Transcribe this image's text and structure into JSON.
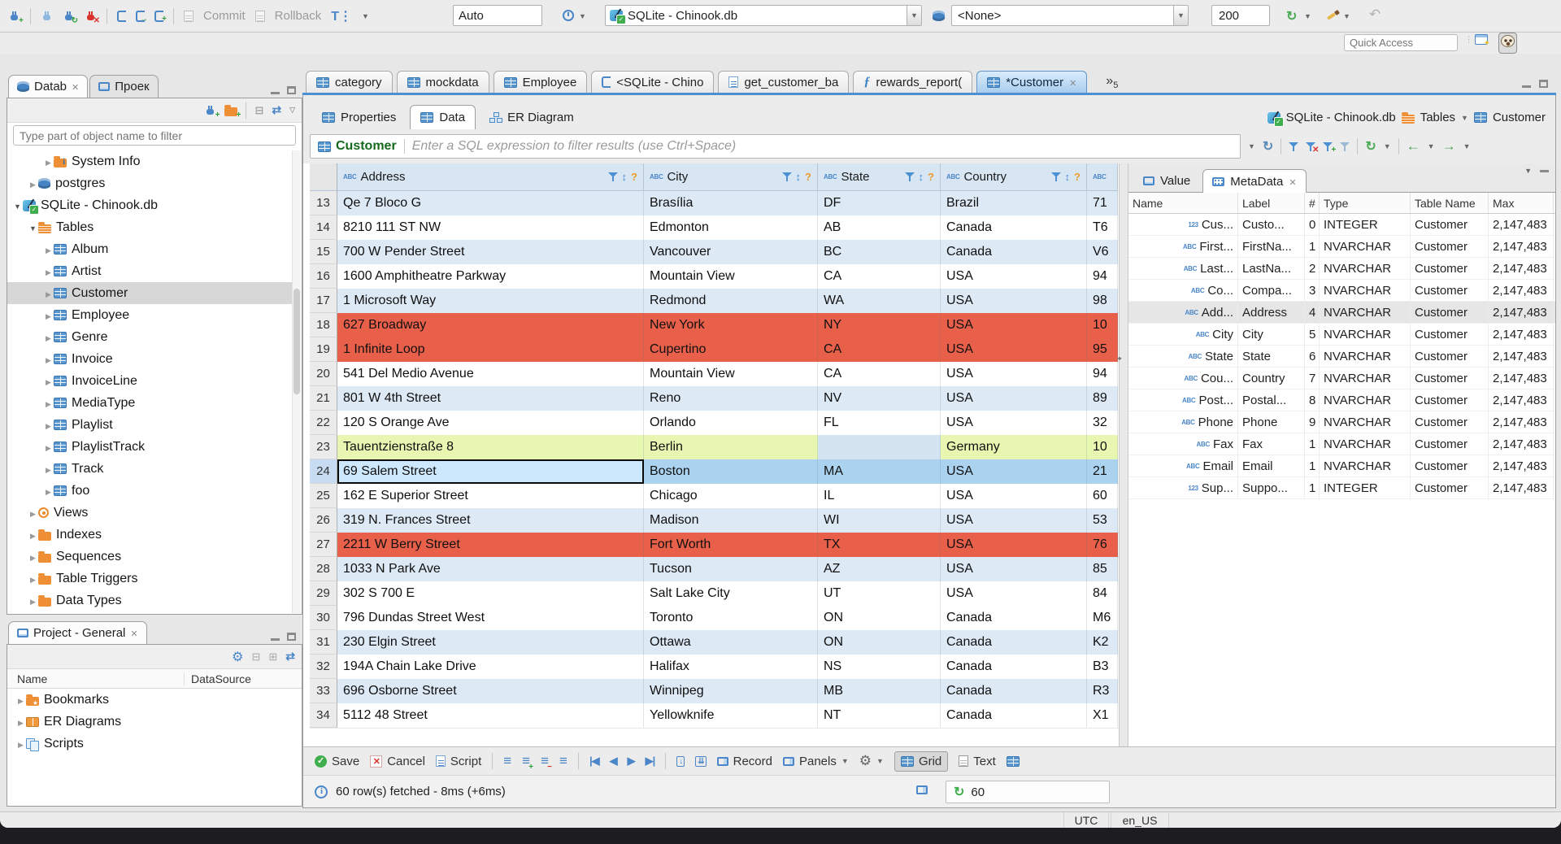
{
  "main_toolbar": {
    "commit_label": "Commit",
    "rollback_label": "Rollback",
    "auto_value": "Auto",
    "connection_value": "SQLite - Chinook.db",
    "schema_value": "<None>",
    "fetch_size_value": "200",
    "quick_access_placeholder": "Quick Access"
  },
  "editor_tabs": {
    "tabs": [
      {
        "label": "category",
        "icon": "table"
      },
      {
        "label": "mockdata",
        "icon": "table"
      },
      {
        "label": "Employee",
        "icon": "table"
      },
      {
        "label": "<SQLite - Chino",
        "icon": "sql"
      },
      {
        "label": "get_customer_ba",
        "icon": "script"
      },
      {
        "label": "rewards_report(",
        "icon": "func"
      },
      {
        "label": "*Customer",
        "icon": "table",
        "active": true,
        "close": true
      }
    ],
    "overflow_chevron": "»",
    "overflow_count": "5"
  },
  "subtabs": {
    "properties": "Properties",
    "data": "Data",
    "er_diagram": "ER Diagram"
  },
  "breadcrumb": {
    "db": "SQLite - Chinook.db",
    "tables": "Tables",
    "table": "Customer"
  },
  "filter_bar": {
    "table_label": "Customer",
    "placeholder": "Enter a SQL expression to filter results (use Ctrl+Space)"
  },
  "navigator": {
    "tab_database": "Datab",
    "tab_projects": "Проек",
    "filter_placeholder": "Type part of object name to filter",
    "tree": [
      {
        "label": "System Info",
        "icon": "folder-info",
        "depth": 3,
        "expander": "collapsed"
      },
      {
        "label": "postgres",
        "icon": "db",
        "depth": 2,
        "expander": "collapsed"
      },
      {
        "label": "SQLite - Chinook.db",
        "icon": "sqlite",
        "depth": 1,
        "expander": "expanded"
      },
      {
        "label": "Tables",
        "icon": "folder-table",
        "depth": 2,
        "expander": "expanded"
      },
      {
        "label": "Album",
        "icon": "table",
        "depth": 3,
        "expander": "collapsed"
      },
      {
        "label": "Artist",
        "icon": "table",
        "depth": 3,
        "expander": "collapsed"
      },
      {
        "label": "Customer",
        "icon": "table",
        "depth": 3,
        "expander": "collapsed",
        "selected": true
      },
      {
        "label": "Employee",
        "icon": "table",
        "depth": 3,
        "expander": "collapsed"
      },
      {
        "label": "Genre",
        "icon": "table",
        "depth": 3,
        "expander": "collapsed"
      },
      {
        "label": "Invoice",
        "icon": "table",
        "depth": 3,
        "expander": "collapsed"
      },
      {
        "label": "InvoiceLine",
        "icon": "table",
        "depth": 3,
        "expander": "collapsed"
      },
      {
        "label": "MediaType",
        "icon": "table",
        "depth": 3,
        "expander": "collapsed"
      },
      {
        "label": "Playlist",
        "icon": "table",
        "depth": 3,
        "expander": "collapsed"
      },
      {
        "label": "PlaylistTrack",
        "icon": "table",
        "depth": 3,
        "expander": "collapsed"
      },
      {
        "label": "Track",
        "icon": "table",
        "depth": 3,
        "expander": "collapsed"
      },
      {
        "label": "foo",
        "icon": "table",
        "depth": 3,
        "expander": "collapsed"
      },
      {
        "label": "Views",
        "icon": "eye",
        "depth": 2,
        "expander": "collapsed"
      },
      {
        "label": "Indexes",
        "icon": "folder",
        "depth": 2,
        "expander": "collapsed"
      },
      {
        "label": "Sequences",
        "icon": "folder",
        "depth": 2,
        "expander": "collapsed"
      },
      {
        "label": "Table Triggers",
        "icon": "folder",
        "depth": 2,
        "expander": "collapsed"
      },
      {
        "label": "Data Types",
        "icon": "folder",
        "depth": 2,
        "expander": "collapsed"
      }
    ]
  },
  "project_panel": {
    "title": "Project - General",
    "col_name": "Name",
    "col_datasource": "DataSource",
    "items": [
      {
        "label": "Bookmarks",
        "icon": "folder-star"
      },
      {
        "label": "ER Diagrams",
        "icon": "erd"
      },
      {
        "label": "Scripts",
        "icon": "scripts"
      }
    ]
  },
  "grid": {
    "columns": [
      "Address",
      "City",
      "State",
      "Country",
      ""
    ],
    "rows": [
      {
        "num": "13",
        "bg": "alt",
        "address": "Qe 7 Bloco G",
        "city": "Brasília",
        "state": "DF",
        "country": "Brazil",
        "postal": "71"
      },
      {
        "num": "14",
        "bg": "white",
        "address": "8210 111 ST NW",
        "city": "Edmonton",
        "state": "AB",
        "country": "Canada",
        "postal": "T6"
      },
      {
        "num": "15",
        "bg": "alt",
        "address": "700 W Pender Street",
        "city": "Vancouver",
        "state": "BC",
        "country": "Canada",
        "postal": "V6"
      },
      {
        "num": "16",
        "bg": "white",
        "address": "1600 Amphitheatre Parkway",
        "city": "Mountain View",
        "state": "CA",
        "country": "USA",
        "postal": "94"
      },
      {
        "num": "17",
        "bg": "alt",
        "address": "1 Microsoft Way",
        "city": "Redmond",
        "state": "WA",
        "country": "USA",
        "postal": "98"
      },
      {
        "num": "18",
        "bg": "red",
        "address": "627 Broadway",
        "city": "New York",
        "state": "NY",
        "country": "USA",
        "postal": "10"
      },
      {
        "num": "19",
        "bg": "red",
        "address": "1 Infinite Loop",
        "city": "Cupertino",
        "state": "CA",
        "country": "USA",
        "postal": "95"
      },
      {
        "num": "20",
        "bg": "white",
        "address": "541 Del Medio Avenue",
        "city": "Mountain View",
        "state": "CA",
        "country": "USA",
        "postal": "94"
      },
      {
        "num": "21",
        "bg": "alt",
        "address": "801 W 4th Street",
        "city": "Reno",
        "state": "NV",
        "country": "USA",
        "postal": "89"
      },
      {
        "num": "22",
        "bg": "white",
        "address": "120 S Orange Ave",
        "city": "Orlando",
        "state": "FL",
        "country": "USA",
        "postal": "32"
      },
      {
        "num": "23",
        "bg": "green",
        "address": "Tauentzienstraße 8",
        "city": "Berlin",
        "state": "",
        "country": "Germany",
        "postal": "10",
        "state_null": true
      },
      {
        "num": "24",
        "bg": "sel",
        "address": "69 Salem Street",
        "city": "Boston",
        "state": "MA",
        "country": "USA",
        "postal": "21",
        "focus": true
      },
      {
        "num": "25",
        "bg": "white",
        "address": "162 E Superior Street",
        "city": "Chicago",
        "state": "IL",
        "country": "USA",
        "postal": "60"
      },
      {
        "num": "26",
        "bg": "alt",
        "address": "319 N. Frances Street",
        "city": "Madison",
        "state": "WI",
        "country": "USA",
        "postal": "53"
      },
      {
        "num": "27",
        "bg": "red",
        "address": "2211 W Berry Street",
        "city": "Fort Worth",
        "state": "TX",
        "country": "USA",
        "postal": "76"
      },
      {
        "num": "28",
        "bg": "alt",
        "address": "1033 N Park Ave",
        "city": "Tucson",
        "state": "AZ",
        "country": "USA",
        "postal": "85"
      },
      {
        "num": "29",
        "bg": "white",
        "address": "302 S 700 E",
        "city": "Salt Lake City",
        "state": "UT",
        "country": "USA",
        "postal": "84"
      },
      {
        "num": "30",
        "bg": "white",
        "address": "796 Dundas Street West",
        "city": "Toronto",
        "state": "ON",
        "country": "Canada",
        "postal": "M6"
      },
      {
        "num": "31",
        "bg": "alt",
        "address": "230 Elgin Street",
        "city": "Ottawa",
        "state": "ON",
        "country": "Canada",
        "postal": "K2"
      },
      {
        "num": "32",
        "bg": "white",
        "address": "194A Chain Lake Drive",
        "city": "Halifax",
        "state": "NS",
        "country": "Canada",
        "postal": "B3"
      },
      {
        "num": "33",
        "bg": "alt",
        "address": "696 Osborne Street",
        "city": "Winnipeg",
        "state": "MB",
        "country": "Canada",
        "postal": "R3"
      },
      {
        "num": "34",
        "bg": "white",
        "address": "5112 48 Street",
        "city": "Yellowknife",
        "state": "NT",
        "country": "Canada",
        "postal": "X1"
      }
    ]
  },
  "metadata": {
    "tab_value": "Value",
    "tab_metadata": "MetaData",
    "columns": [
      "Name",
      "Label",
      "#",
      "Type",
      "Table Name",
      "Max"
    ],
    "rows": [
      {
        "icon": "123",
        "name": "Cus...",
        "label": "Custo...",
        "num": "0",
        "type": "INTEGER",
        "table": "Customer",
        "max": "2,147,483"
      },
      {
        "icon": "abc",
        "name": "First...",
        "label": "FirstNa...",
        "num": "1",
        "type": "NVARCHAR",
        "table": "Customer",
        "max": "2,147,483"
      },
      {
        "icon": "abc",
        "name": "Last...",
        "label": "LastNa...",
        "num": "2",
        "type": "NVARCHAR",
        "table": "Customer",
        "max": "2,147,483"
      },
      {
        "icon": "abc",
        "name": "Co...",
        "label": "Compa...",
        "num": "3",
        "type": "NVARCHAR",
        "table": "Customer",
        "max": "2,147,483"
      },
      {
        "icon": "abc",
        "name": "Add...",
        "label": "Address",
        "num": "4",
        "type": "NVARCHAR",
        "table": "Customer",
        "max": "2,147,483",
        "selected": true
      },
      {
        "icon": "abc",
        "name": "City",
        "label": "City",
        "num": "5",
        "type": "NVARCHAR",
        "table": "Customer",
        "max": "2,147,483"
      },
      {
        "icon": "abc",
        "name": "State",
        "label": "State",
        "num": "6",
        "type": "NVARCHAR",
        "table": "Customer",
        "max": "2,147,483"
      },
      {
        "icon": "abc",
        "name": "Cou...",
        "label": "Country",
        "num": "7",
        "type": "NVARCHAR",
        "table": "Customer",
        "max": "2,147,483"
      },
      {
        "icon": "abc",
        "name": "Post...",
        "label": "Postal...",
        "num": "8",
        "type": "NVARCHAR",
        "table": "Customer",
        "max": "2,147,483"
      },
      {
        "icon": "abc",
        "name": "Phone",
        "label": "Phone",
        "num": "9",
        "type": "NVARCHAR",
        "table": "Customer",
        "max": "2,147,483"
      },
      {
        "icon": "abc",
        "name": "Fax",
        "label": "Fax",
        "num": "1",
        "type": "NVARCHAR",
        "table": "Customer",
        "max": "2,147,483"
      },
      {
        "icon": "abc",
        "name": "Email",
        "label": "Email",
        "num": "1",
        "type": "NVARCHAR",
        "table": "Customer",
        "max": "2,147,483"
      },
      {
        "icon": "123",
        "name": "Sup...",
        "label": "Suppo...",
        "num": "1",
        "type": "INTEGER",
        "table": "Customer",
        "max": "2,147,483"
      }
    ]
  },
  "bottom_toolbar": {
    "save_label": "Save",
    "cancel_label": "Cancel",
    "script_label": "Script",
    "record_label": "Record",
    "panels_label": "Panels",
    "grid_label": "Grid",
    "text_label": "Text"
  },
  "status": {
    "fetch_text": "60 row(s) fetched - 8ms (+6ms)",
    "refresh_value": "60"
  },
  "statusbar": {
    "timezone": "UTC",
    "locale": "en_US"
  },
  "icons": {
    "text_type": "ABC",
    "numeric_type": "123"
  }
}
